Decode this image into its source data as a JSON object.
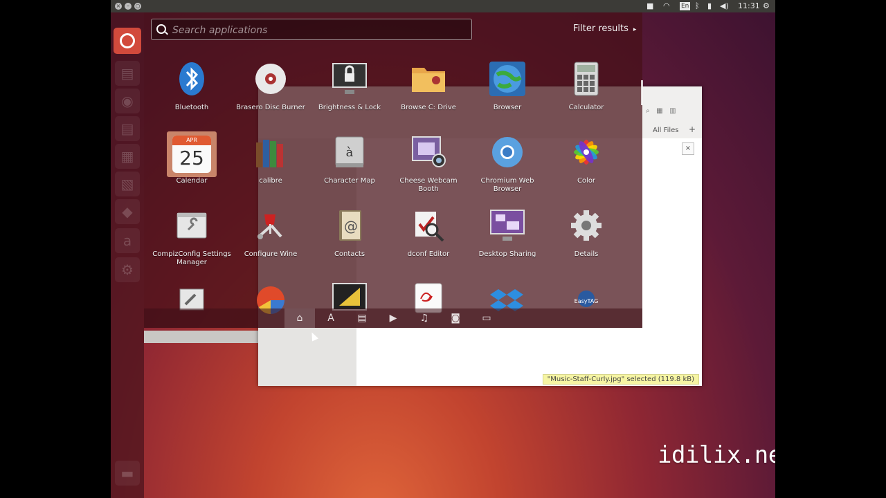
{
  "top_panel": {
    "window_controls": [
      "close",
      "minimize",
      "maximize"
    ],
    "indicators": {
      "camera": "camera-icon",
      "wifi": "wifi-icon",
      "keyboard": "En",
      "bluetooth": "bluetooth-icon",
      "battery": "battery-icon",
      "volume": "volume-icon",
      "time": "11:31",
      "settings": "gear-icon"
    }
  },
  "dash": {
    "search": {
      "placeholder": "Search applications",
      "value": ""
    },
    "filter_results": "Filter results",
    "apps": [
      {
        "label": "Bluetooth",
        "icon": "bluetooth-icon"
      },
      {
        "label": "Brasero Disc Burner",
        "icon": "disc-icon"
      },
      {
        "label": "Brightness & Lock",
        "icon": "monitor-lock-icon"
      },
      {
        "label": "Browse C: Drive",
        "icon": "folder-icon"
      },
      {
        "label": "Browser",
        "icon": "globe-icon"
      },
      {
        "label": "Calculator",
        "icon": "calculator-icon"
      },
      {
        "label": "Calendar",
        "icon": "calendar-icon",
        "badge_month": "APR",
        "badge_day": "25"
      },
      {
        "label": "calibre",
        "icon": "books-icon"
      },
      {
        "label": "Character Map",
        "icon": "character-map-icon",
        "glyph": "à"
      },
      {
        "label": "Cheese Webcam Booth",
        "icon": "webcam-icon"
      },
      {
        "label": "Chromium Web Browser",
        "icon": "chromium-icon"
      },
      {
        "label": "Color",
        "icon": "color-icon"
      },
      {
        "label": "CompizConfig Settings Manager",
        "icon": "compiz-icon"
      },
      {
        "label": "Configure Wine",
        "icon": "wine-icon"
      },
      {
        "label": "Contacts",
        "icon": "contacts-icon"
      },
      {
        "label": "dconf Editor",
        "icon": "dconf-icon"
      },
      {
        "label": "Desktop Sharing",
        "icon": "desktop-sharing-icon"
      },
      {
        "label": "Details",
        "icon": "gear-icon"
      },
      {
        "label": "",
        "icon": "tools-icon"
      },
      {
        "label": "",
        "icon": "pie-chart-icon"
      },
      {
        "label": "",
        "icon": "drawing-icon"
      },
      {
        "label": "",
        "icon": "document-viewer-icon"
      },
      {
        "label": "",
        "icon": "dropbox-icon"
      },
      {
        "label": "",
        "icon": "easytag-icon",
        "text": "EasyTAG"
      }
    ],
    "lenses": [
      {
        "name": "home",
        "icon": "home-icon",
        "glyph": "⌂",
        "active": true
      },
      {
        "name": "applications",
        "icon": "applications-icon",
        "glyph": "A",
        "active": false
      },
      {
        "name": "files",
        "icon": "files-icon",
        "glyph": "▤",
        "active": false
      },
      {
        "name": "video",
        "icon": "video-icon",
        "glyph": "▶",
        "active": false
      },
      {
        "name": "music",
        "icon": "music-icon",
        "glyph": "♫",
        "active": false
      },
      {
        "name": "photos",
        "icon": "photo-icon",
        "glyph": "◙",
        "active": false
      },
      {
        "name": "social",
        "icon": "social-icon",
        "glyph": "▭",
        "active": false
      }
    ]
  },
  "launcher": {
    "icons": [
      "dash-home-icon",
      "files-launcher-icon",
      "firefox-icon",
      "writer-icon",
      "calc-icon",
      "impress-icon",
      "software-center-icon",
      "amazon-icon",
      "settings-launcher-icon",
      "trash-icon"
    ]
  },
  "file_window": {
    "all_files": "All Files",
    "status": "\"Music-Staff-Curly.jpg\" selected (119.8 kB)",
    "close": "×"
  },
  "watermark": "idilix.net"
}
